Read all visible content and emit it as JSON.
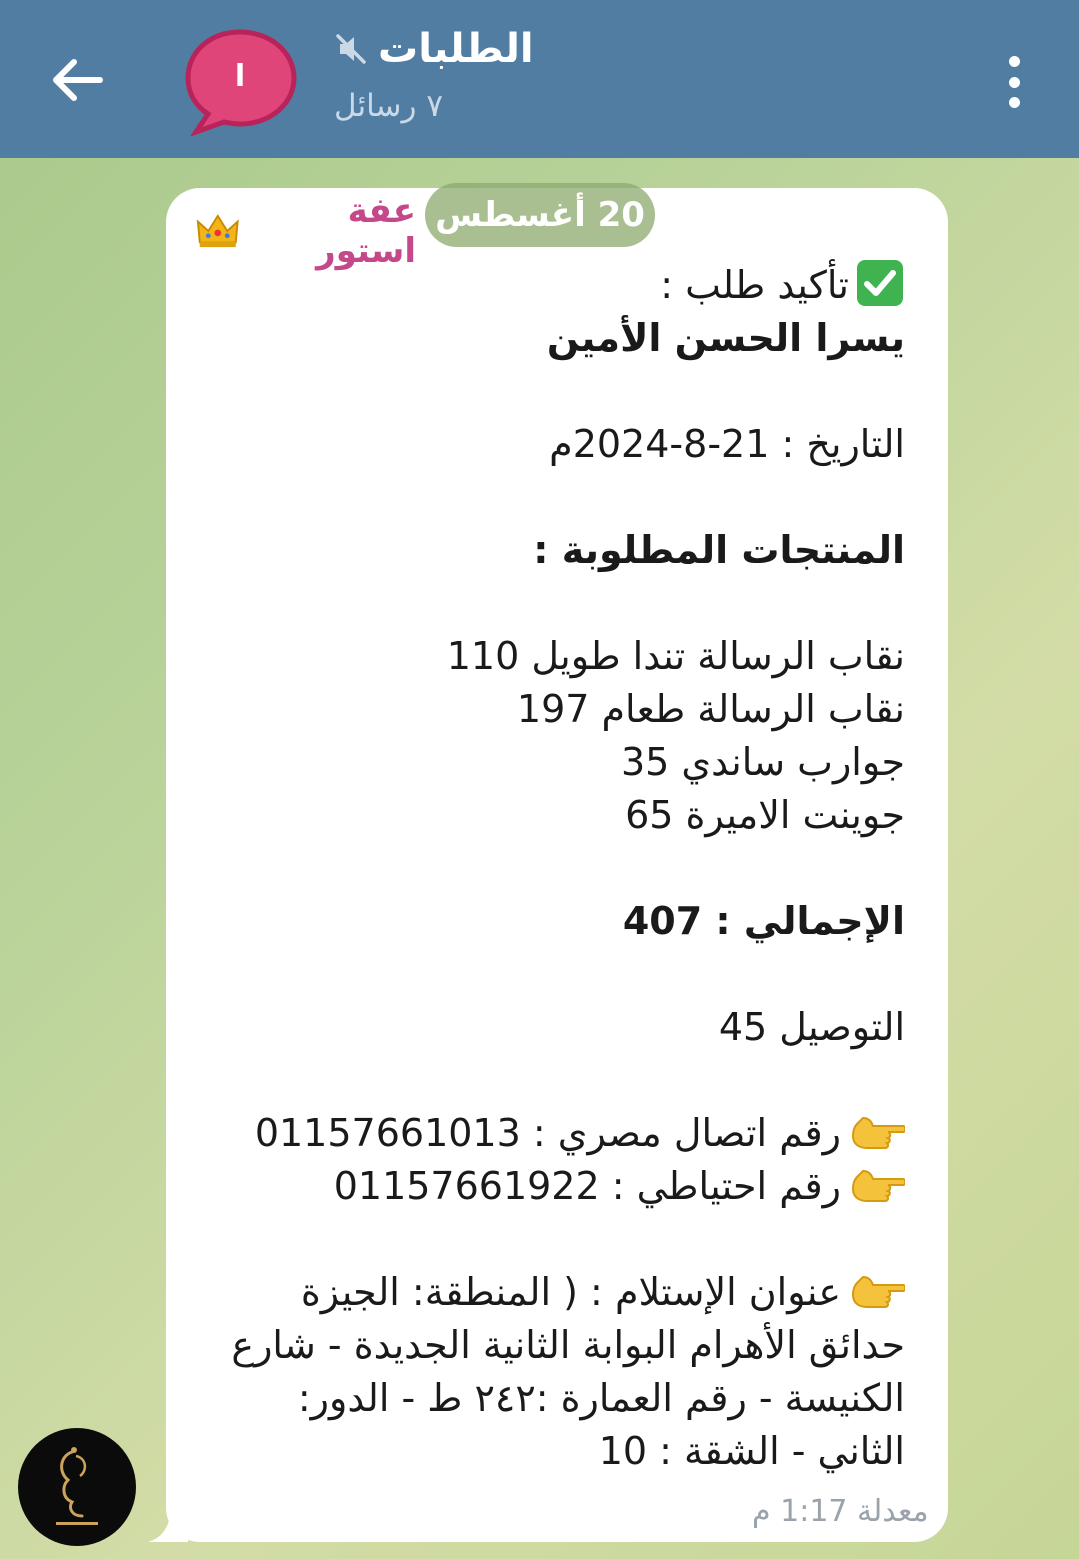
{
  "header": {
    "title": "الطلبات",
    "subtitle": "٧ رسائل",
    "avatar_letter": "ا",
    "back_icon": "arrow-left-icon",
    "mute_icon": "muted-speaker-icon",
    "menu_icon": "more-vertical-icon"
  },
  "date_pill": "20 أغسطس",
  "message": {
    "sender": "عفة استور",
    "sender_icon": "crown-icon",
    "confirm_label": "تأكيد طلب :",
    "customer": "يسرا الحسن الأمين",
    "date_line": "التاريخ : 21-8-2024م",
    "products_heading": "المنتجات المطلوبة :",
    "products": [
      "نقاب الرسالة تندا طويل 110",
      "نقاب الرسالة طعام 197",
      "جوارب ساندي 35",
      "جوينت الاميرة 65"
    ],
    "total_line": "الإجمالي : 407",
    "delivery_line": "التوصيل 45",
    "phone_main": "رقم اتصال مصري : 01157661013",
    "phone_backup": "رقم احتياطي : 01157661922",
    "address": "عنوان الإستلام : ( المنطقة: الجيزة حدائق الأهرام البوابة الثانية الجديدة - شارع الكنيسة - رقم العمارة :٢٤٢ ط - الدور: الثاني - الشقة : 10",
    "edited_time": "معدلة 1:17 م"
  },
  "colors": {
    "header": "#527da3",
    "sender": "#c4488a",
    "avatar": "#e0457a"
  }
}
